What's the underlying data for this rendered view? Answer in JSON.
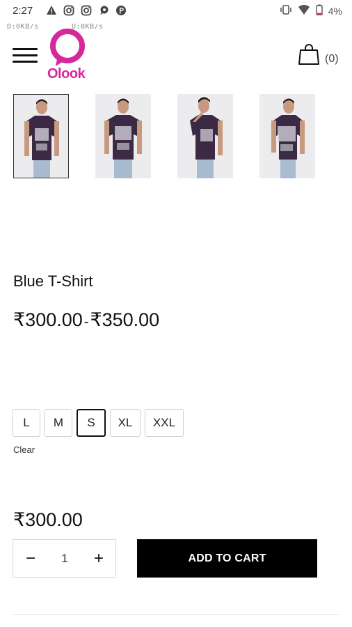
{
  "status_bar": {
    "time": "2:27",
    "battery": "4%",
    "download_speed": "D:0KB/s",
    "upload_speed": "U:0KB/s",
    "left_icons": [
      "warning-icon",
      "instagram-icon",
      "instagram-icon",
      "chat-icon",
      "parking-icon"
    ],
    "right_icons": [
      "vibrate-icon",
      "wifi-icon",
      "battery-low-icon"
    ]
  },
  "header": {
    "brand": "Olook",
    "brand_color": "#d5289a",
    "cart_count": "(0)"
  },
  "gallery": {
    "images": [
      {
        "name": "product-image-front",
        "active": true
      },
      {
        "name": "product-image-front-2",
        "active": false
      },
      {
        "name": "product-image-pose",
        "active": false
      },
      {
        "name": "product-image-side",
        "active": false
      }
    ]
  },
  "product": {
    "title": "Blue T-Shirt",
    "price_min": "₹300.00",
    "price_separator": "-",
    "price_max": "₹350.00",
    "sizes": [
      "L",
      "M",
      "S",
      "XL",
      "XXL"
    ],
    "selected_size": "S",
    "clear_label": "Clear",
    "current_price": "₹300.00"
  },
  "purchase": {
    "quantity": "1",
    "minus_label": "−",
    "plus_label": "+",
    "add_to_cart_label": "ADD TO CART"
  }
}
